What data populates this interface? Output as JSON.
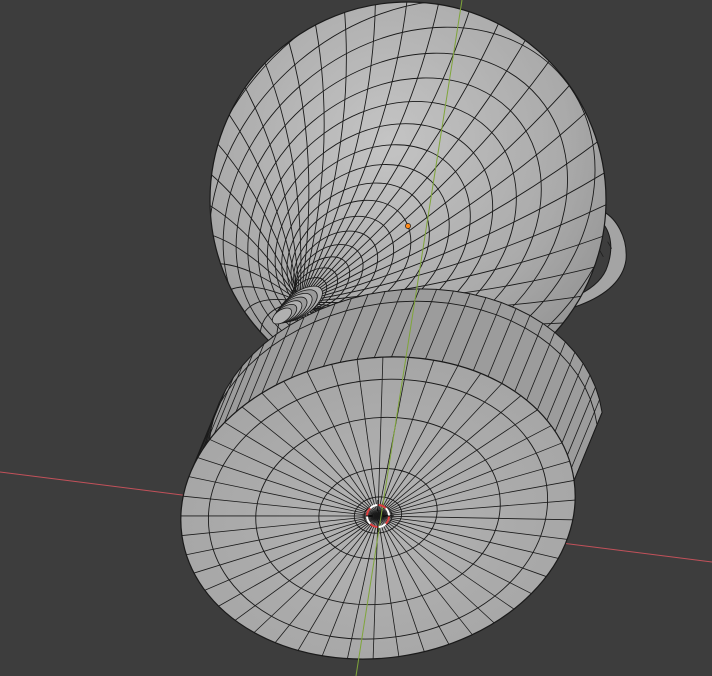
{
  "viewport": {
    "label": "",
    "background": "#3d3d3d"
  },
  "colors": {
    "x_axis": "#c2515a",
    "y_axis": "#7fa53a",
    "mesh_fill": "#a9a9a9",
    "mesh_fill_light": "#b7b7b7",
    "mesh_fill_dark": "#8e8e8e",
    "wire": "#1a1a1a",
    "origin": "#ff8a1a",
    "cursor_red": "#e04040",
    "cursor_white": "#ffffff"
  },
  "objects": [
    {
      "name": "sphere",
      "icon": "uv-sphere-icon"
    },
    {
      "name": "cylinder",
      "icon": "cylinder-icon"
    },
    {
      "name": "torus-ring",
      "icon": "torus-icon"
    }
  ]
}
